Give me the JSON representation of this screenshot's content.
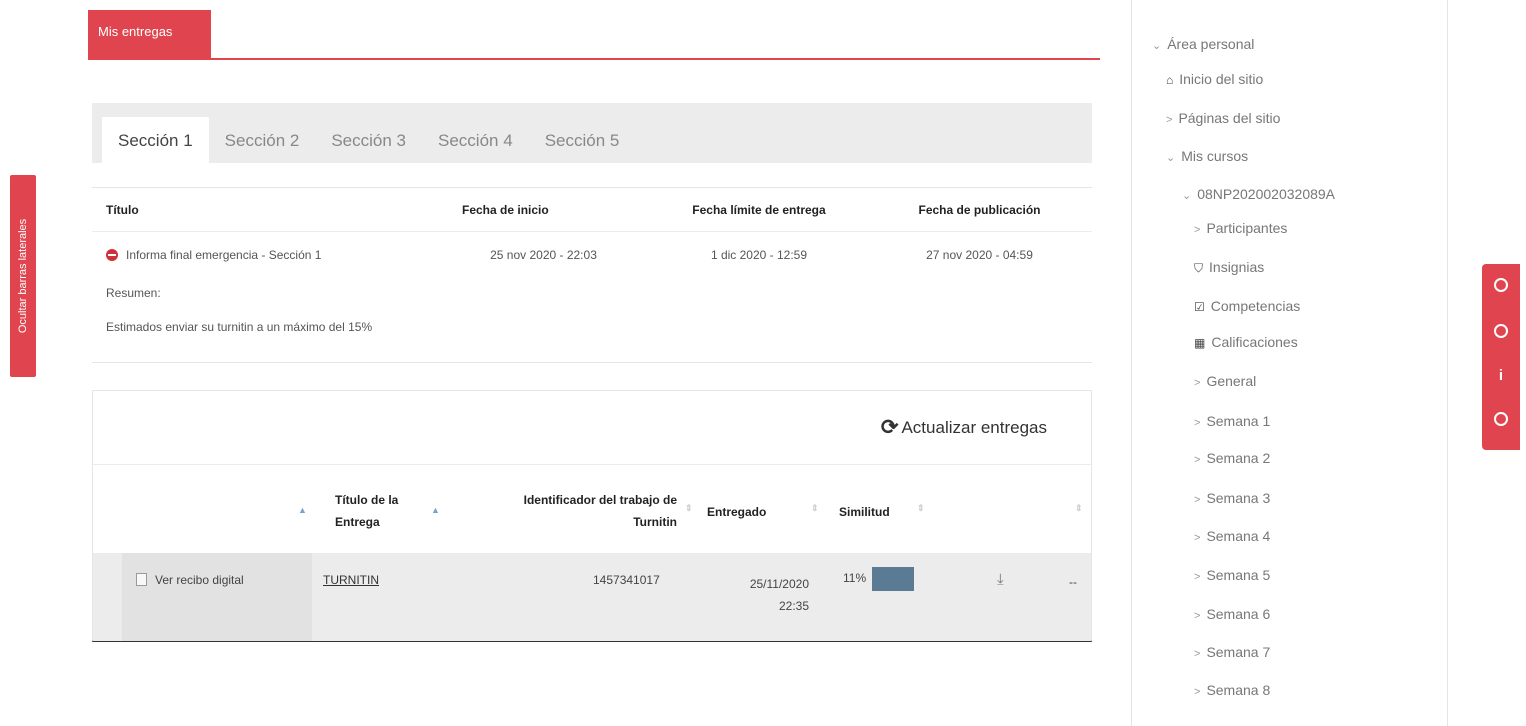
{
  "sidebar_toggle": {
    "label": "Ocultar barras laterales"
  },
  "header_tab": {
    "label": "Mis entregas"
  },
  "section_tabs": [
    "Sección 1",
    "Sección 2",
    "Sección 3",
    "Sección 4",
    "Sección 5"
  ],
  "active_section": "Sección 1",
  "assignment_table": {
    "headers": [
      "Título",
      "Fecha de inicio",
      "Fecha límite de entrega",
      "Fecha de publicación"
    ],
    "row": {
      "title": "Informa final emergencia - Sección 1",
      "start": "25 nov 2020 - 22:03",
      "due": "1 dic 2020 - 12:59",
      "published": "27 nov 2020 - 04:59"
    },
    "summary_label": "Resumen:",
    "summary_text": "Estimados enviar su turnitin a un máximo del 15%"
  },
  "submissions": {
    "refresh_label": "Actualizar entregas",
    "headers": {
      "title_line1": "Título de la",
      "title_line2": "Entrega",
      "id_line1": "Identificador del trabajo de",
      "id_line2": "Turnitin",
      "submitted": "Entregado",
      "similarity": "Similitud"
    },
    "row": {
      "receipt_link": "Ver recibo digital",
      "title_link": "TURNITIN",
      "paper_id": "1457341017",
      "submitted_date": "25/11/2020",
      "submitted_time": "22:35",
      "similarity": "11%",
      "similarity_value": 11,
      "trailing": "--"
    }
  },
  "nav": {
    "area_personal": "Área personal",
    "inicio": "Inicio del sitio",
    "paginas": "Páginas del sitio",
    "mis_cursos": "Mis cursos",
    "curso": "08NP202002032089A",
    "participantes": "Participantes",
    "insignias": "Insignias",
    "competencias": "Competencias",
    "calificaciones": "Calificaciones",
    "general": "General",
    "semanas": [
      "Semana 1",
      "Semana 2",
      "Semana 3",
      "Semana 4",
      "Semana 5",
      "Semana 6",
      "Semana 7",
      "Semana 8"
    ]
  },
  "colors": {
    "accent": "#e0454f",
    "similarity_bar": "#5b7a94"
  }
}
